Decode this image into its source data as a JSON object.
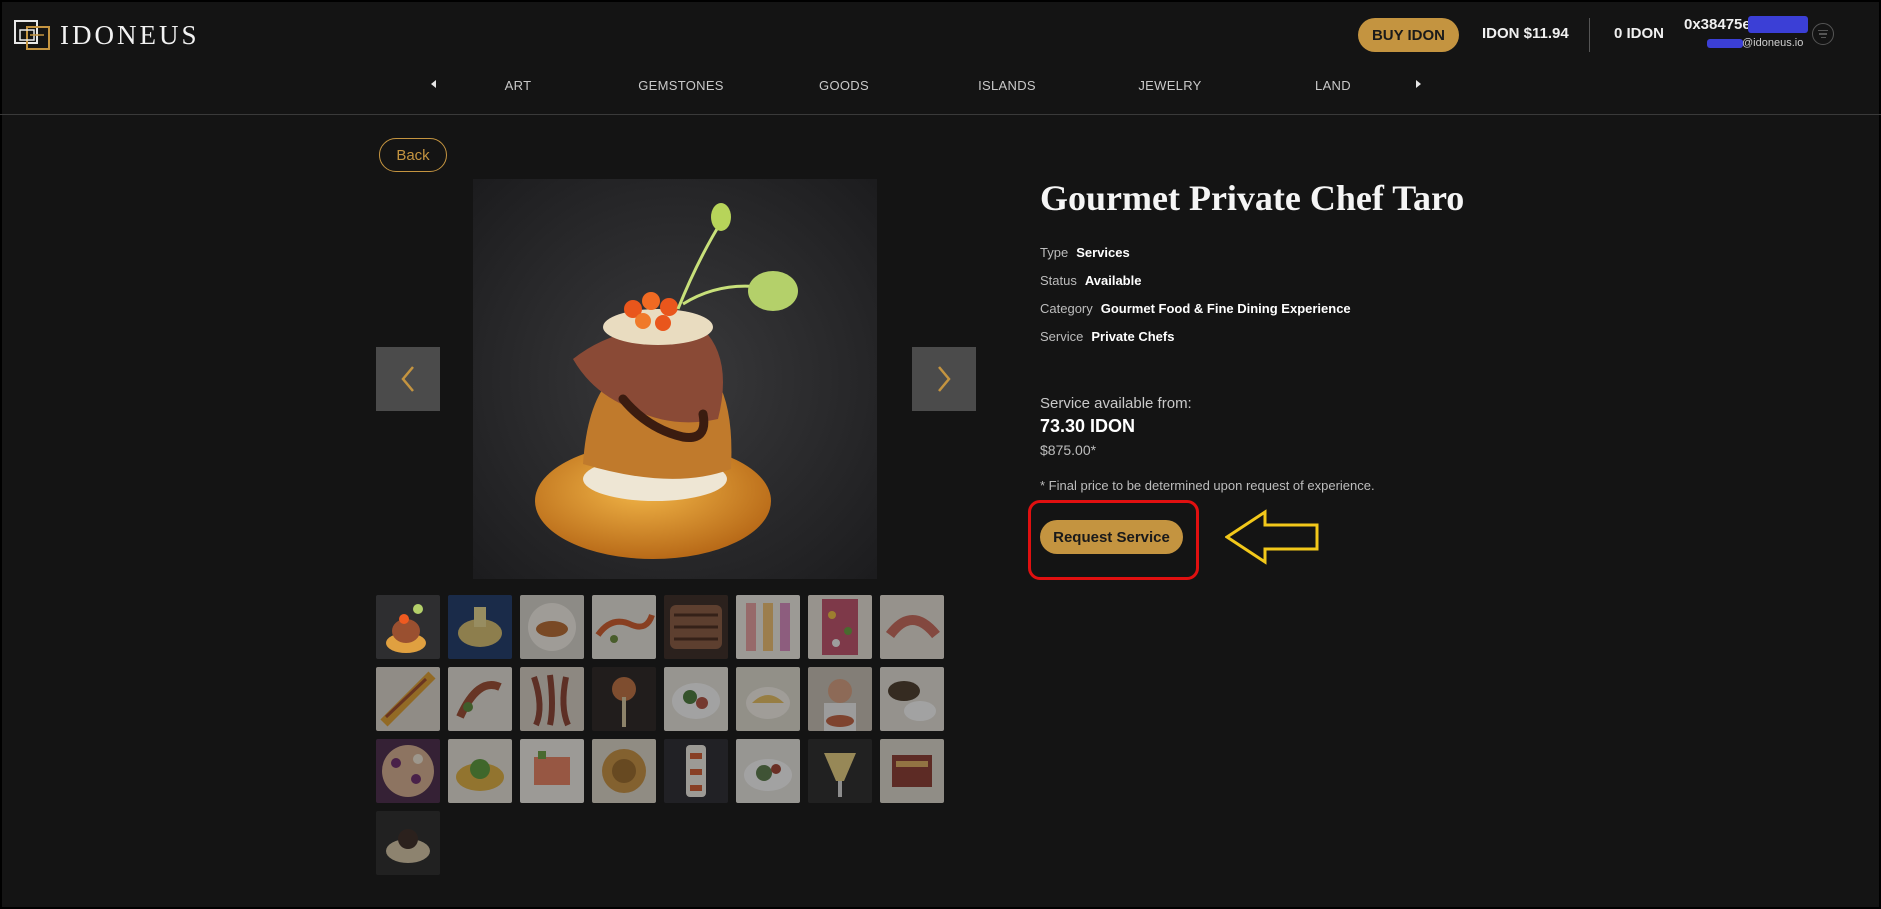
{
  "header": {
    "logo_text": "IDONEUS",
    "buy_button": "BUY IDON",
    "idon_price": "IDON $11.94",
    "idon_balance": "0 IDON",
    "wallet_address": "0x38475e.",
    "wallet_email": "@idoneus.io",
    "accent_color": "#c49440"
  },
  "nav": {
    "categories": [
      "ART",
      "GEMSTONES",
      "GOODS",
      "ISLANDS",
      "JEWELRY",
      "LAND"
    ]
  },
  "listing": {
    "back_label": "Back",
    "title": "Gourmet Private Chef Taro",
    "type_label": "Type",
    "type_value": "Services",
    "status_label": "Status",
    "status_value": "Available",
    "category_label": "Category",
    "category_value": "Gourmet Food & Fine Dining Experience",
    "service_label": "Service",
    "service_value": "Private Chefs",
    "available_from_label": "Service available from:",
    "price_idon": "73.30 IDON",
    "price_usd": "$875.00*",
    "price_note": "* Final price to be determined upon request of experience.",
    "request_button": "Request Service"
  },
  "gallery": {
    "thumbnail_count": 25,
    "selected_index": 0
  },
  "annotation": {
    "highlight_color": "#e01010",
    "arrow_color": "#f2c81a"
  }
}
